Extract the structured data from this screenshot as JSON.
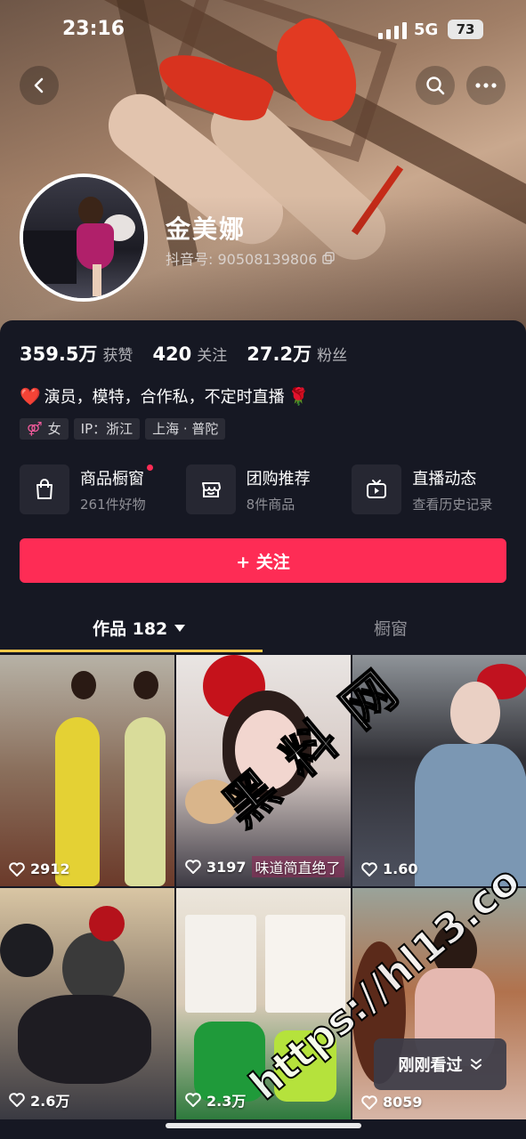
{
  "status_bar": {
    "time": "23:16",
    "network": "5G",
    "battery": "73"
  },
  "header": {
    "back_icon": "chevron-left-icon",
    "search_icon": "search-icon",
    "more_icon": "more-dots-icon"
  },
  "profile": {
    "name": "金美娜",
    "douyin_id": "抖音号: 90508139806",
    "copy_icon": "copy-icon"
  },
  "stats": [
    {
      "value": "359.5万",
      "label": "获赞"
    },
    {
      "value": "420",
      "label": "关注"
    },
    {
      "value": "27.2万",
      "label": "粉丝"
    }
  ],
  "bio": {
    "prefix_emoji": "❤️",
    "text": "演员，模特，合作私，不定时直播",
    "suffix_emoji": "🌹"
  },
  "tags": [
    {
      "icon": "female-icon",
      "label": "女"
    },
    {
      "label": "IP：浙江"
    },
    {
      "label": "上海 · 普陀"
    }
  ],
  "features": [
    {
      "icon": "shopping-bag-icon",
      "title": "商品橱窗",
      "subtitle": "261件好物",
      "has_dot": true
    },
    {
      "icon": "store-icon",
      "title": "团购推荐",
      "subtitle": "8件商品",
      "has_dot": false
    },
    {
      "icon": "tv-icon",
      "title": "直播动态",
      "subtitle": "查看历史记录",
      "has_dot": false
    }
  ],
  "follow_button": {
    "label": "+ 关注"
  },
  "tabs": {
    "works": "作品 182",
    "showcase": "橱窗"
  },
  "videos": [
    {
      "likes": "2912",
      "overlay": ""
    },
    {
      "likes": "3197",
      "overlay": "味道简直绝了"
    },
    {
      "likes": "1.60",
      "overlay": ""
    },
    {
      "likes": "2.6万",
      "overlay": ""
    },
    {
      "likes": "2.3万",
      "overlay": ""
    },
    {
      "likes": "8059",
      "overlay": ""
    }
  ],
  "recently_viewed": {
    "label": "刚刚看过"
  },
  "watermark": {
    "line1": "黑 料 网",
    "line2": "https://hl13.co"
  },
  "colors": {
    "accent": "#fe2c55",
    "background": "#161823",
    "tab_underline": "#fbc94a"
  }
}
